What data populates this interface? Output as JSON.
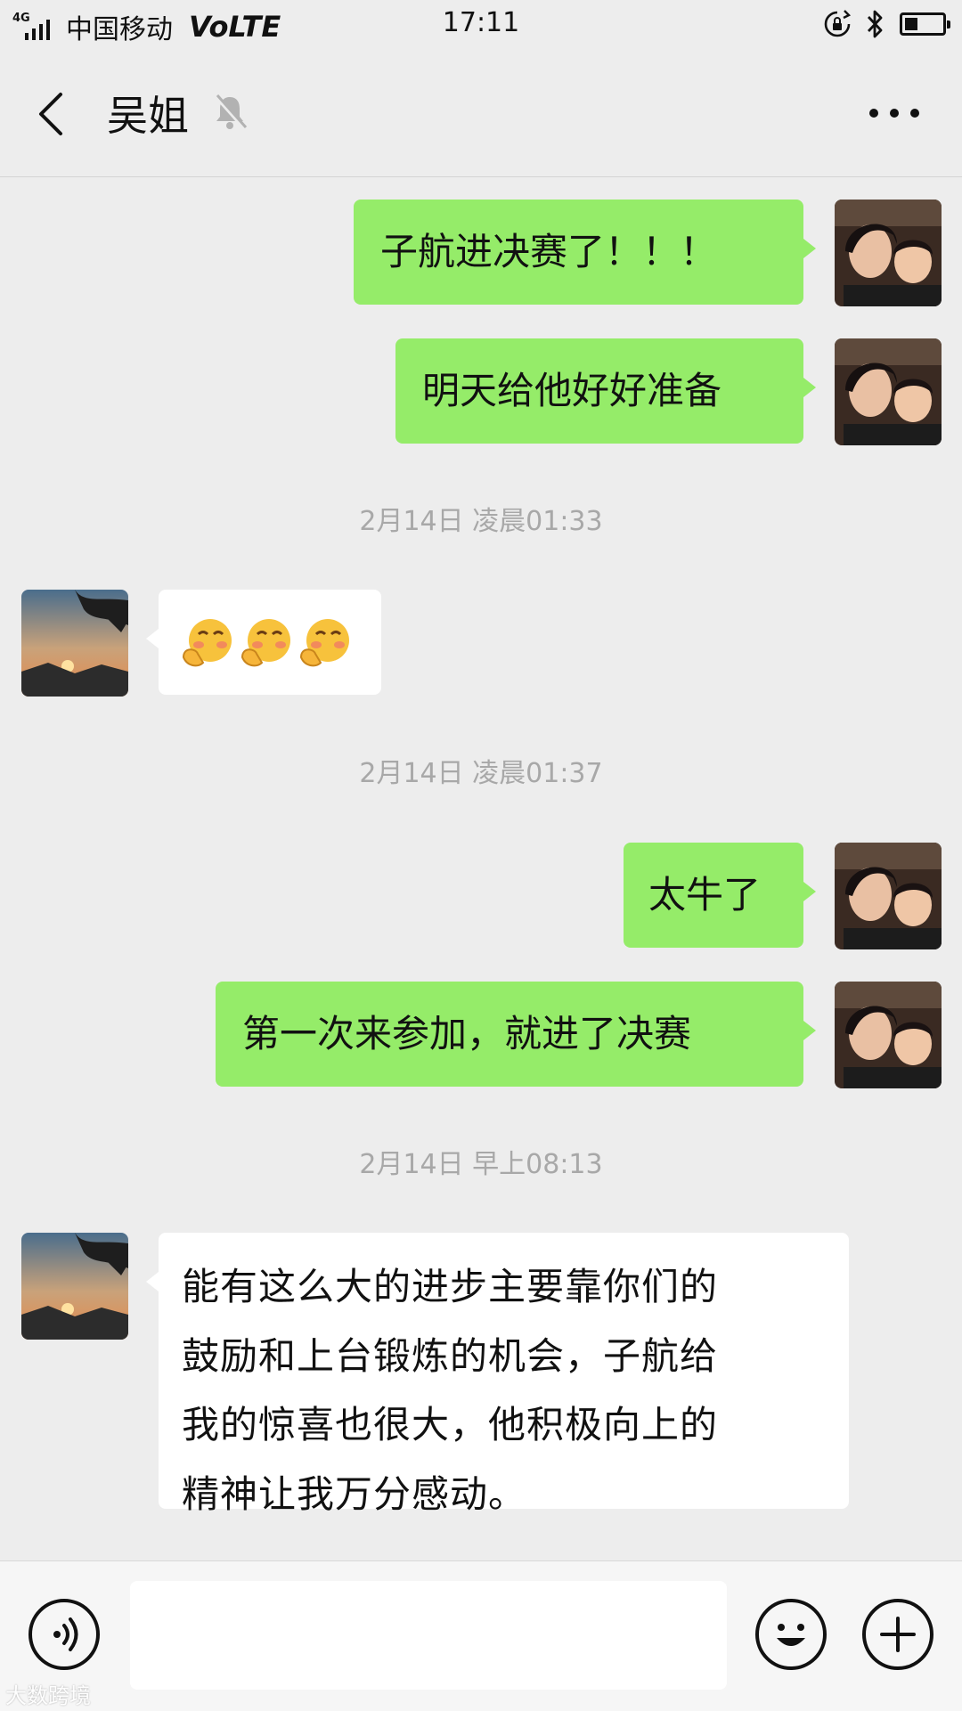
{
  "status_bar": {
    "network": "4G",
    "carrier": "中国移动",
    "volte": "VoLTE",
    "time": "17:11"
  },
  "header": {
    "title": "吴姐",
    "icons": [
      "back-arrow-icon",
      "muted-bell-icon",
      "more-icon"
    ]
  },
  "messages": [
    {
      "side": "out",
      "text": "子航进决赛了！！！"
    },
    {
      "side": "out",
      "text": "明天给他好好准备"
    },
    {
      "type": "timestamp",
      "text": "2月14日 凌晨01:33"
    },
    {
      "side": "in",
      "emoji": [
        "blush-emoji",
        "blush-emoji",
        "blush-emoji"
      ]
    },
    {
      "type": "timestamp",
      "text": "2月14日 凌晨01:37"
    },
    {
      "side": "out",
      "text": "太牛了"
    },
    {
      "side": "out",
      "text": "第一次来参加，就进了决赛"
    },
    {
      "type": "timestamp",
      "text": "2月14日 早上08:13"
    },
    {
      "side": "in",
      "lines": [
        "能有这么大的进步主要靠你们的",
        "鼓励和上台锻炼的机会，子航给",
        "我的惊喜也很大，他积极向上的",
        "精神让我万分感动。"
      ]
    }
  ],
  "input_bar": {
    "value": "",
    "icons": [
      "voice-icon",
      "emoji-icon",
      "plus-icon"
    ]
  },
  "watermark": "大数跨境",
  "colors": {
    "background": "#ededed",
    "outgoing_bubble": "#95ec69",
    "incoming_bubble": "#ffffff",
    "timestamp": "#a8a8a8"
  }
}
